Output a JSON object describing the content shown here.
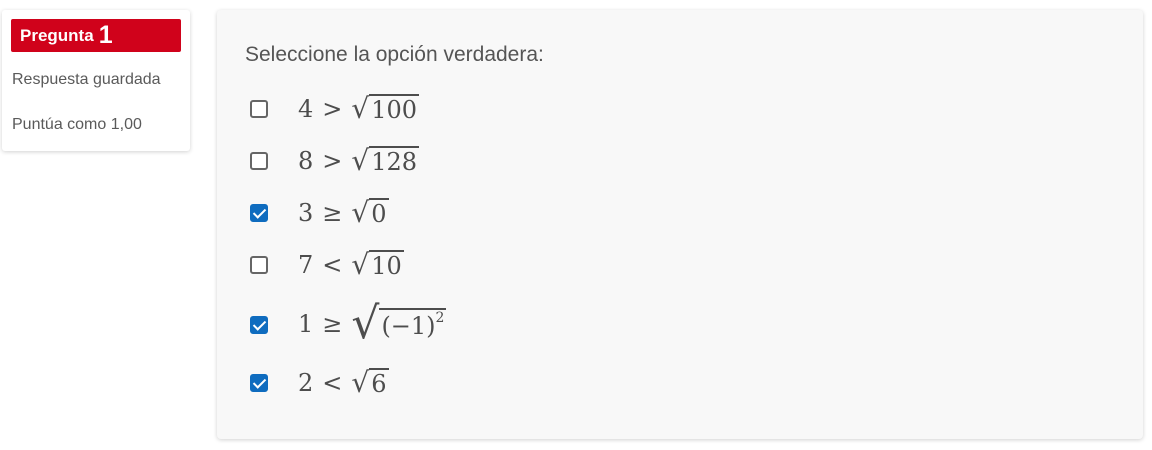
{
  "info": {
    "label": "Pregunta",
    "number": "1",
    "status": "Respuesta guardada",
    "grade": "Puntúa como 1,00"
  },
  "question": {
    "prompt": "Seleccione la opción verdadera:",
    "options": [
      {
        "lhs": "4",
        "op": ">",
        "radicand": "100",
        "checked": false
      },
      {
        "lhs": "8",
        "op": ">",
        "radicand": "128",
        "checked": false
      },
      {
        "lhs": "3",
        "op": "≥",
        "radicand": "0",
        "checked": true
      },
      {
        "lhs": "7",
        "op": "<",
        "radicand": "10",
        "checked": false
      },
      {
        "lhs": "1",
        "op": "≥",
        "radicand": "(−1)",
        "exponent": "2",
        "checked": true
      },
      {
        "lhs": "2",
        "op": "<",
        "radicand": "6",
        "checked": true
      }
    ]
  },
  "colors": {
    "badge": "#d0021b",
    "checkbox_checked": "#0f6cbf"
  }
}
